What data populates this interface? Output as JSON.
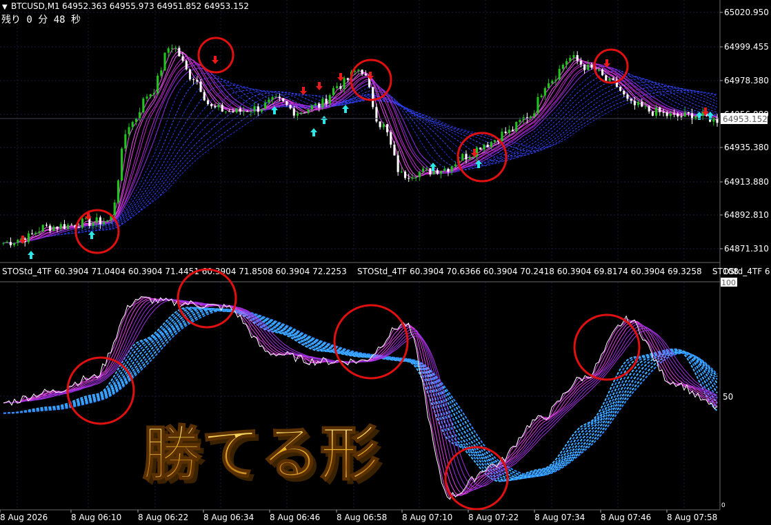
{
  "header": {
    "symbol": "BTCUSD,M1",
    "ohlc": "64952.363 64955.973 64951.852 64953.152",
    "timer": "残り 0 分 48 秒"
  },
  "price_axis": {
    "ticks": [
      "65020.950",
      "64999.455",
      "64978.380",
      "64956.880",
      "64935.380",
      "64913.880",
      "64892.810",
      "64871.310"
    ],
    "current_price": "64953.152"
  },
  "indicator": {
    "label": "STOStd_4TF 60.3904 71.0404 60.3904 71.4451 60.3904 71.8508 60.3904 72.2253    STOStd_4TF 60.3904 70.6366 60.3904 70.2418 60.3904 69.8174 60.3904 69.3258    STOStd_4TF 6",
    "axis_top": "108",
    "axis_100": "100",
    "axis_50": "50",
    "axis_0": "0"
  },
  "time_axis": [
    "8 Aug 2026",
    "8 Aug 06:10",
    "8 Aug 06:22",
    "8 Aug 06:34",
    "8 Aug 06:46",
    "8 Aug 06:58",
    "8 Aug 07:10",
    "8 Aug 07:22",
    "8 Aug 07:34",
    "8 Aug 07:46",
    "8 Aug 07:58"
  ],
  "overlay_text": "勝てる形",
  "colors": {
    "bull": "#22c41e",
    "bear": "#ffffff",
    "ribbon_fast": "#d82ad8",
    "ribbon_slow": "#2a3bff",
    "osc_main": "#ffffff",
    "osc_signal": "#39a8ff",
    "arrow_up": "#2be6e6",
    "arrow_down": "#e81a1a",
    "circle": "#e01010",
    "grid": "#1a1a3a",
    "overlay_gold": "#f2b21e"
  },
  "chart_data": [
    {
      "type": "candlestick",
      "title": "BTCUSD,M1",
      "ylim": [
        64871.31,
        65020.95
      ],
      "x": [
        "8 Aug 2026",
        "8 Aug 06:10",
        "8 Aug 06:22",
        "8 Aug 06:34",
        "8 Aug 06:46",
        "8 Aug 06:58",
        "8 Aug 07:10",
        "8 Aug 07:22",
        "8 Aug 07:34",
        "8 Aug 07:46",
        "8 Aug 07:58"
      ],
      "close_path": [
        64875,
        64878,
        64885,
        64886,
        64888,
        64889,
        64950,
        64970,
        65000,
        64980,
        64960,
        64958,
        64960,
        64965,
        64958,
        64962,
        64975,
        64985,
        64950,
        64918,
        64920,
        64922,
        64930,
        64938,
        64945,
        64955,
        64978,
        64992,
        64985,
        64976,
        64962,
        64958,
        64955,
        64956,
        64953
      ],
      "up_arrows_times": [
        "8 Aug 06:10",
        "8 Aug 06:46",
        "8 Aug 06:58",
        "8 Aug 07:10",
        "8 Aug 07:22",
        "8 Aug 07:58"
      ],
      "down_arrows_times": [
        "8 Aug 06:10",
        "8 Aug 06:34",
        "8 Aug 06:46",
        "8 Aug 06:58",
        "8 Aug 07:22",
        "8 Aug 07:46"
      ]
    },
    {
      "type": "line",
      "title": "STOStd_4TF",
      "ylim": [
        0,
        108
      ],
      "x": [
        "8 Aug 2026",
        "8 Aug 06:10",
        "8 Aug 06:22",
        "8 Aug 06:34",
        "8 Aug 06:46",
        "8 Aug 06:58",
        "8 Aug 07:10",
        "8 Aug 07:22",
        "8 Aug 07:34",
        "8 Aug 07:46",
        "8 Aug 07:58"
      ],
      "series": [
        {
          "values": [
            50,
            55,
            62,
            100,
            98,
            96,
            74,
            70,
            70,
            88,
            5,
            20,
            42,
            62,
            90,
            60,
            48
          ]
        },
        {
          "values": [
            45,
            48,
            54,
            80,
            96,
            94,
            84,
            75,
            72,
            70,
            30,
            12,
            18,
            40,
            72,
            76,
            45
          ]
        }
      ]
    }
  ]
}
